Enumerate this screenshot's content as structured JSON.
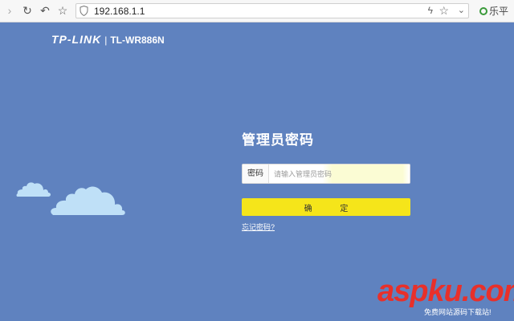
{
  "browser": {
    "url": "192.168.1.1",
    "extension_text": "乐平"
  },
  "brand": {
    "logo": "TP-LINK",
    "separator": "|",
    "model": "TL-WR886N"
  },
  "login": {
    "title": "管理员密码",
    "password_label": "密码",
    "password_placeholder": "请输入管理员密码",
    "confirm_label": "确 定",
    "forgot_link": "忘记密码?"
  },
  "watermark": {
    "main": "aspku.com",
    "sub": "免费网站源码下载站!"
  },
  "colors": {
    "background": "#5f82bf",
    "confirm_button": "#f5e51a",
    "cloud": "#bfe0f7"
  }
}
